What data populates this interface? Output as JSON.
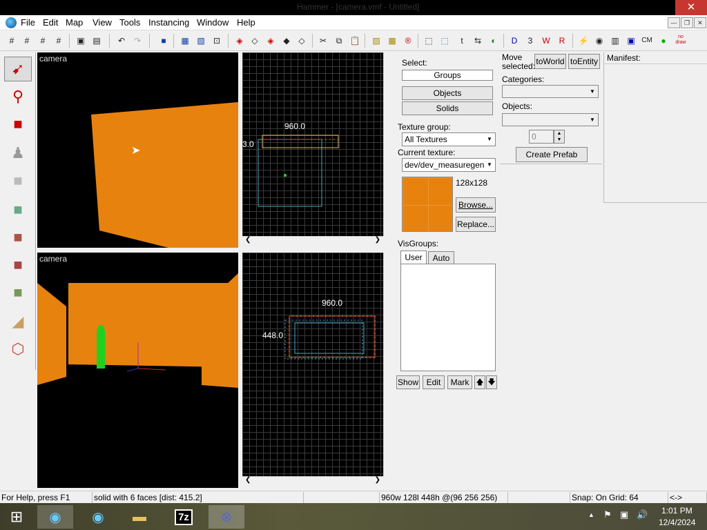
{
  "window": {
    "title": "Hammer - [camera.vmf - Untitled]",
    "close_symbol": "✕"
  },
  "menu": {
    "items": [
      "File",
      "Edit",
      "Map",
      "View",
      "Tools",
      "Instancing",
      "Window",
      "Help"
    ]
  },
  "toolbar": {
    "cm_label": "CM",
    "nodraw_label": "no draw"
  },
  "viewports": {
    "top_left_label": "camera",
    "bottom_left_label": "camera",
    "top_right_width": "960.0",
    "top_right_height": "3.0",
    "bottom_right_width": "960.0",
    "bottom_right_height": "448.0"
  },
  "select_panel": {
    "title": "Select:",
    "groups": "Groups",
    "objects": "Objects",
    "solids": "Solids",
    "texture_group_label": "Texture group:",
    "texture_group_value": "All Textures",
    "current_texture_label": "Current texture:",
    "current_texture_value": "dev/dev_measuregene",
    "texture_size": "128x128",
    "browse": "Browse...",
    "replace": "Replace...",
    "visgroups_label": "VisGroups:",
    "tab_user": "User",
    "tab_auto": "Auto",
    "show": "Show",
    "edit": "Edit",
    "mark": "Mark"
  },
  "move_panel": {
    "move_selected": "Move selected:",
    "to_world": "toWorld",
    "to_entity": "toEntity",
    "categories": "Categories:",
    "objects": "Objects:",
    "spinner_value": "0",
    "create_prefab": "Create Prefab"
  },
  "manifest": {
    "label": "Manifest:"
  },
  "status": {
    "help": "For Help, press F1",
    "selection": "solid with 6 faces  [dist: 415.2]",
    "dims": "960w 128l 448h @(96 256 256)",
    "snap": "Snap: On Grid: 64",
    "arrows": "<->"
  },
  "taskbar": {
    "time": "1:01 PM",
    "date": "12/4/2024",
    "sevenzip": "7z"
  },
  "colors": {
    "texture": "#e8820e",
    "grid": "#3a3a3a",
    "selection": "#ff3333",
    "visgroup": "#00ff00"
  }
}
